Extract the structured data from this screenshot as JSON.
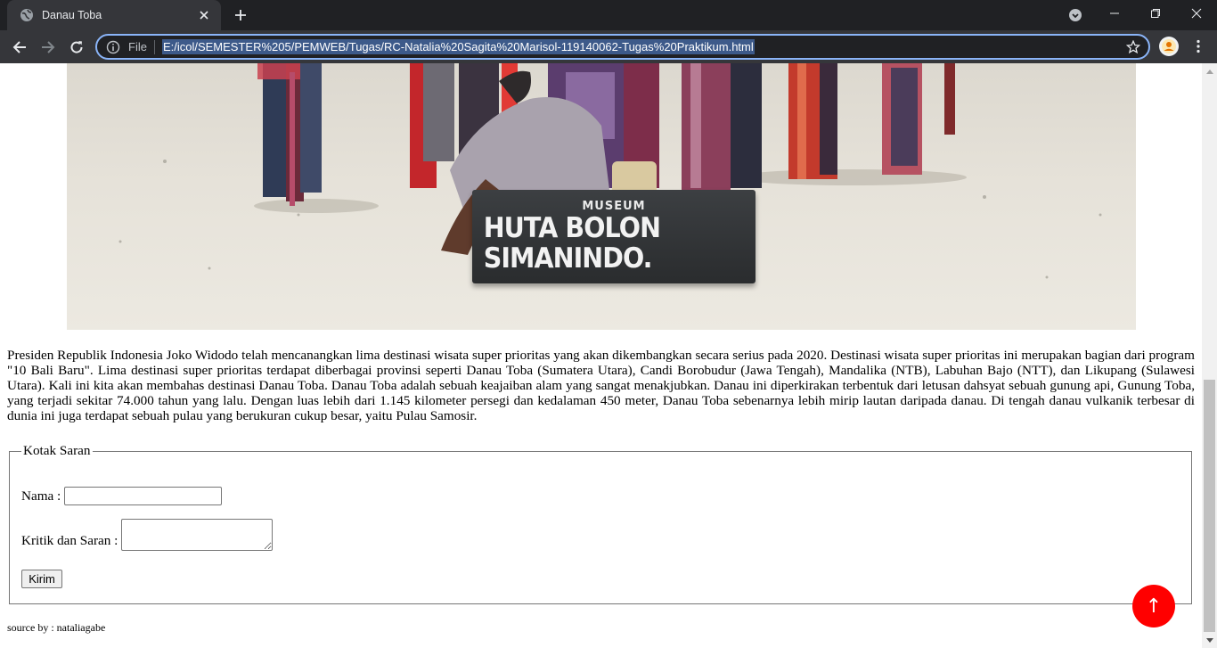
{
  "browser": {
    "tab_title": "Danau Toba",
    "scheme_label": "File",
    "url": "E:/icol/SEMESTER%205/PEMWEB/Tugas/RC-Natalia%20Sagita%20Marisol-119140062-Tugas%20Praktikum.html"
  },
  "hero": {
    "museum_label_small": "MUSEUM",
    "museum_label_big": "HUTA BOLON SIMANINDO."
  },
  "article": {
    "paragraph": "Presiden Republik Indonesia Joko Widodo telah mencanangkan lima destinasi wisata super prioritas yang akan dikembangkan secara serius pada 2020. Destinasi wisata super prioritas ini merupakan bagian dari program \"10 Bali Baru\". Lima destinasi super prioritas terdapat diberbagai provinsi seperti Danau Toba (Sumatera Utara), Candi Borobudur (Jawa Tengah), Mandalika (NTB), Labuhan Bajo (NTT), dan Likupang (Sulawesi Utara). Kali ini kita akan membahas destinasi Danau Toba. Danau Toba adalah sebuah keajaiban alam yang sangat menakjubkan. Danau ini diperkirakan terbentuk dari letusan dahsyat sebuah gunung api, Gunung Toba, yang terjadi sekitar 74.000 tahun yang lalu. Dengan luas lebih dari 1.145 kilometer persegi dan kedalaman 450 meter, Danau Toba sebenarnya lebih mirip lautan daripada danau. Di tengah danau vulkanik terbesar di dunia ini juga terdapat sebuah pulau yang berukuran cukup besar, yaitu Pulau Samosir."
  },
  "form": {
    "legend": "Kotak Saran",
    "nama_label": "Nama :",
    "nama_value": "",
    "kritik_label": "Kritik dan Saran :",
    "kritik_value": "",
    "submit_label": "Kirim"
  },
  "footer": {
    "source": "source by : nataliagabe"
  },
  "to_top_label": "↑",
  "colors": {
    "to_top": "#ff0000",
    "chrome_dark": "#202124",
    "chrome_toolbar": "#35363a",
    "omnibox_focus": "#8ab4f8"
  },
  "icons": [
    "globe-icon",
    "tab-close-icon",
    "new-tab-icon",
    "tab-search-icon",
    "minimize-icon",
    "restore-icon",
    "window-close-icon",
    "back-icon",
    "forward-icon",
    "reload-icon",
    "info-icon",
    "bookmark-star-icon",
    "profile-avatar-icon",
    "menu-kebab-icon",
    "scroll-up-icon",
    "scroll-down-icon"
  ]
}
